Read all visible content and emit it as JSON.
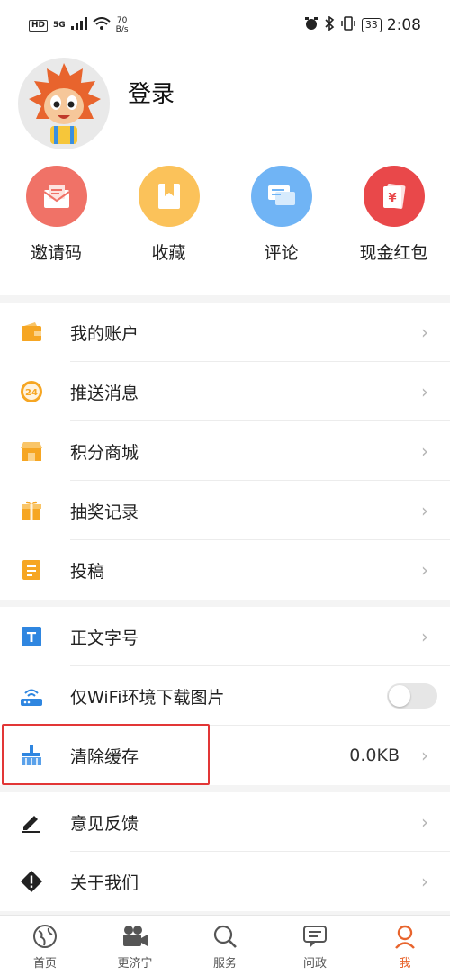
{
  "status_bar": {
    "hd": "HD",
    "signal": "5G",
    "speed_value": "70",
    "speed_unit": "B/s",
    "battery": "33",
    "time": "2:08"
  },
  "profile": {
    "login_label": "登录"
  },
  "quick_actions": [
    {
      "label": "邀请码",
      "icon": "invite-icon",
      "color": "#f07267"
    },
    {
      "label": "收藏",
      "icon": "favorite-icon",
      "color": "#fbc25a"
    },
    {
      "label": "评论",
      "icon": "comment-icon",
      "color": "#70b4f5"
    },
    {
      "label": "现金红包",
      "icon": "red-envelope-icon",
      "color": "#e9484a"
    }
  ],
  "menu_group_1": [
    {
      "label": "我的账户",
      "icon": "wallet-icon"
    },
    {
      "label": "推送消息",
      "icon": "push-24-icon",
      "badge": "24"
    },
    {
      "label": "积分商城",
      "icon": "shop-icon"
    },
    {
      "label": "抽奖记录",
      "icon": "gift-icon"
    },
    {
      "label": "投稿",
      "icon": "document-icon"
    }
  ],
  "menu_group_2": [
    {
      "label": "正文字号",
      "icon": "font-size-icon",
      "glyph": "T"
    },
    {
      "label": "仅WiFi环境下载图片",
      "icon": "wifi-router-icon",
      "toggle": false
    },
    {
      "label": "清除缓存",
      "icon": "broom-icon",
      "value": "0.0KB"
    }
  ],
  "menu_group_3": [
    {
      "label": "意见反馈",
      "icon": "pencil-icon"
    },
    {
      "label": "关于我们",
      "icon": "info-diamond-icon"
    }
  ],
  "chevron": "›",
  "bottom_nav": [
    {
      "label": "首页",
      "icon": "globe-icon",
      "active": false
    },
    {
      "label": "更济宁",
      "icon": "camera-icon",
      "active": false
    },
    {
      "label": "服务",
      "icon": "search-icon",
      "active": false
    },
    {
      "label": "问政",
      "icon": "chat-icon",
      "active": false
    },
    {
      "label": "我",
      "icon": "profile-icon",
      "active": true
    }
  ],
  "colors": {
    "accent": "#e8642d",
    "highlight_border": "#e23636",
    "icon_orange": "#f6a623",
    "icon_blue": "#2f86e0"
  }
}
